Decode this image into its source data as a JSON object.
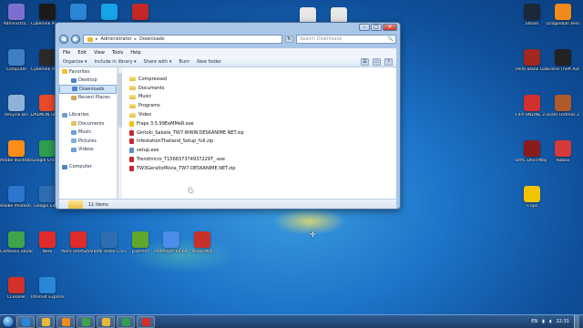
{
  "desktop": {
    "icons_left": [
      {
        "label": "Administra...",
        "icon": "user-folder-icon",
        "color": "#7d6fd0"
      },
      {
        "label": "Computer",
        "icon": "computer-icon",
        "color": "#3f7fc4"
      },
      {
        "label": "Recycle Bin",
        "icon": "recycle-bin-icon",
        "color": "#8fb3d8"
      },
      {
        "label": "Adobe Illustrato...",
        "icon": "illustrator-icon",
        "color": "#ff8d1a"
      },
      {
        "label": "Adobe Photosh...",
        "icon": "photoshop-icon",
        "color": "#2d76cf"
      },
      {
        "label": "Camtasia Studio 8",
        "icon": "camtasia-icon",
        "color": "#3ea34b"
      },
      {
        "label": "CCleaner",
        "icon": "ccleaner-icon",
        "color": "#d3302a"
      }
    ],
    "icons_col2": [
      {
        "label": "Cyberlink PowerDV...",
        "icon": "powerdvd-icon",
        "color": "#1a1a1a"
      },
      {
        "label": "Cyberlink YouCam",
        "icon": "youcam-icon",
        "color": "#2a2a2a"
      },
      {
        "label": "DAEMON Tools Lite",
        "icon": "daemon-tools-icon",
        "color": "#e84a2a"
      },
      {
        "label": "Google Chrome",
        "icon": "chrome-icon",
        "color": "#2e9e4f"
      },
      {
        "label": "Google Earth",
        "icon": "google-earth-icon",
        "color": "#2f6db3"
      },
      {
        "label": "Nero",
        "icon": "nero-icon",
        "color": "#e02b2b"
      },
      {
        "label": "Internet Explorer",
        "icon": "ie-icon",
        "color": "#2a86d6"
      }
    ],
    "icons_row_top": [
      {
        "label": "",
        "icon": "ie-icon",
        "color": "#2a86d6"
      },
      {
        "label": "",
        "icon": "skype-icon",
        "color": "#17a3e8"
      },
      {
        "label": "",
        "icon": "shield-icon",
        "color": "#c62828"
      }
    ],
    "icons_bottom_row": [
      {
        "label": "Nero StartSmart",
        "icon": "nero-icon",
        "color": "#e02b2b"
      },
      {
        "label": "Total Video Converter",
        "icon": "converter-icon",
        "color": "#2f6db3"
      },
      {
        "label": "µTorrent",
        "icon": "utorrent-icon",
        "color": "#5fa82a"
      },
      {
        "label": "PotPlayer 64 bit",
        "icon": "potplayer-icon",
        "color": "#4b8de8"
      },
      {
        "label": "Audio Wiz",
        "icon": "audio-icon",
        "color": "#c8302a"
      }
    ],
    "icons_right": [
      {
        "label": "Steam",
        "icon": "steam-icon",
        "color": "#1b2838"
      },
      {
        "label": "Point Blank Garena",
        "icon": "pointblank-icon",
        "color": "#a0281e"
      },
      {
        "label": "FIFA ONLINE 3 (Thailand)",
        "icon": "fifa-icon",
        "color": "#d32f2f"
      },
      {
        "label": "DmC Devil May Cry",
        "icon": "dmc-icon",
        "color": "#8a1c1c"
      },
      {
        "label": "Fraps",
        "icon": "fraps-icon",
        "color": "#f2c400"
      }
    ],
    "icons_right2": [
      {
        "label": "Dragonball Xenoverse",
        "icon": "dragonball-icon",
        "color": "#f08a1c"
      },
      {
        "label": "Grand Theft Auto IV",
        "icon": "gta-icon",
        "color": "#222222"
      },
      {
        "label": "Team Fortress 2",
        "icon": "tf2-icon",
        "color": "#b05a2a"
      },
      {
        "label": "Roblox",
        "icon": "roblox-icon",
        "color": "#d63a3a"
      }
    ],
    "icons_top_mid": [
      {
        "label": "",
        "icon": "doc-icon",
        "color": "#e7e7e7"
      },
      {
        "label": "",
        "icon": "doc-icon",
        "color": "#e7e7e7"
      }
    ]
  },
  "explorer": {
    "address": {
      "segments": [
        "Administrator",
        "Downloads"
      ],
      "separator": "▸"
    },
    "search_placeholder": "Search Downloads",
    "menu": [
      "File",
      "Edit",
      "View",
      "Tools",
      "Help"
    ],
    "toolbar": [
      "Organize ▾",
      "Include in library ▾",
      "Share with ▾",
      "Burn",
      "New folder"
    ],
    "nav_pane": [
      {
        "label": "Favorites",
        "icon": "star-icon",
        "color": "#f1c232",
        "indent": 0
      },
      {
        "label": "Desktop",
        "icon": "desktop-icon",
        "color": "#4a86c8",
        "indent": 1
      },
      {
        "label": "Downloads",
        "icon": "downloads-icon",
        "color": "#4a86c8",
        "indent": 1,
        "selected": true
      },
      {
        "label": "Recent Places",
        "icon": "recent-icon",
        "color": "#c9a65b",
        "indent": 1
      },
      {
        "label": "",
        "icon": "",
        "color": "",
        "indent": 0
      },
      {
        "label": "Libraries",
        "icon": "library-icon",
        "color": "#6f9fd8",
        "indent": 0
      },
      {
        "label": "Documents",
        "icon": "documents-icon",
        "color": "#e3c25a",
        "indent": 1
      },
      {
        "label": "Music",
        "icon": "music-icon",
        "color": "#6fa0d6",
        "indent": 1
      },
      {
        "label": "Pictures",
        "icon": "pictures-icon",
        "color": "#7fb0e0",
        "indent": 1
      },
      {
        "label": "Videos",
        "icon": "videos-icon",
        "color": "#6f9fd8",
        "indent": 1
      },
      {
        "label": "",
        "icon": "",
        "color": "",
        "indent": 0
      },
      {
        "label": "Computer",
        "icon": "computer-icon",
        "color": "#4a86c8",
        "indent": 0
      }
    ],
    "files": [
      {
        "name": "Compressed",
        "type": "folder"
      },
      {
        "name": "Documents",
        "type": "folder"
      },
      {
        "name": "Music",
        "type": "folder"
      },
      {
        "name": "Programs",
        "type": "folder"
      },
      {
        "name": "Video",
        "type": "folder"
      },
      {
        "name": "Fraps 3.5.99EeMMeR.exe",
        "type": "exe",
        "color": "#f2c400"
      },
      {
        "name": "Gintoki_Sakata_TW7-WWW.DESKANIME.NET.zip",
        "type": "zip",
        "color": "#c62828"
      },
      {
        "name": "InfestationThailand_Setup_full.zip",
        "type": "zip",
        "color": "#c62828"
      },
      {
        "name": "setup.exe",
        "type": "exe",
        "color": "#5a8ed0"
      },
      {
        "name": "Trendmicro_T156837374937229T_.exe",
        "type": "exe",
        "color": "#c62828"
      },
      {
        "name": "TW3GeraltofRivia_TW7-DESKANIME.NET.zip",
        "type": "zip",
        "color": "#c62828"
      }
    ],
    "status": "11 items"
  },
  "taskbar": {
    "buttons": [
      {
        "icon": "ie-icon",
        "color": "#2a86d6"
      },
      {
        "icon": "explorer-icon",
        "color": "#e6b93a"
      },
      {
        "icon": "media-player-icon",
        "color": "#f08a1c"
      },
      {
        "icon": "camtasia-icon",
        "color": "#3ea34b"
      },
      {
        "icon": "folder-icon",
        "color": "#e6b93a"
      },
      {
        "icon": "chrome-icon",
        "color": "#2e9e4f"
      },
      {
        "icon": "recorder-icon",
        "color": "#d3302a"
      }
    ],
    "language": "EN",
    "time": "22:31"
  }
}
